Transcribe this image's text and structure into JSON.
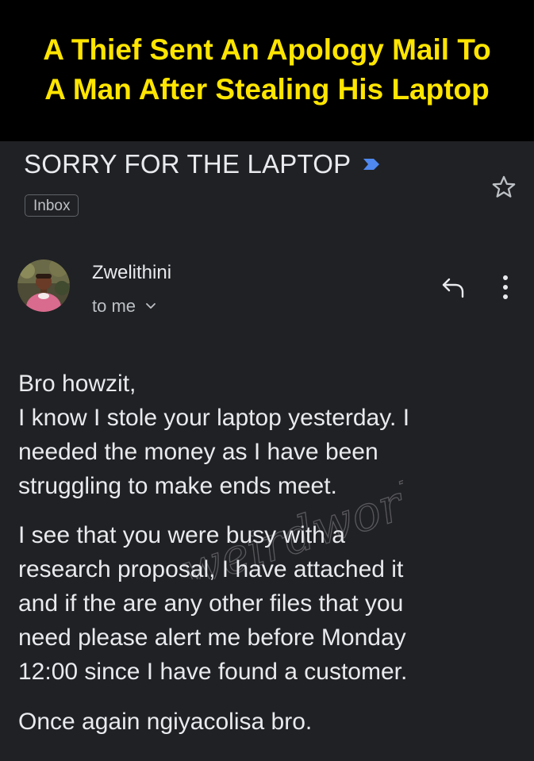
{
  "banner": {
    "title_line1": "A Thief Sent An Apology Mail To",
    "title_line2": "A Man After Stealing His Laptop"
  },
  "email": {
    "subject": "SORRY FOR THE LAPTOP",
    "label": "Inbox",
    "sender": "Zwelithini",
    "recipient": "to me",
    "body": {
      "p1": [
        "Bro howzit,",
        "I know I stole your laptop yesterday. I",
        "needed the money as I have been",
        "struggling to make ends meet."
      ],
      "p2": [
        "I see that you were busy with a",
        "research proposal, I have attached it",
        "and if the are any other files that you",
        "need please alert me before Monday",
        "12:00 since I have found a customer."
      ],
      "p3": [
        "Once again ngiyacolisa bro."
      ]
    }
  },
  "watermark": "weirdworld",
  "icons": {
    "importance": "importance-marker-icon",
    "star": "star-icon",
    "reply": "reply-icon",
    "more": "more-vert-icon",
    "chevron": "chevron-down-icon"
  },
  "colors": {
    "banner_bg": "#000000",
    "banner_text": "#ffe500",
    "app_bg": "#202124",
    "text_primary": "#e8eaed",
    "text_secondary": "#bdc1c6",
    "importance_marker": "#4f88ee"
  }
}
